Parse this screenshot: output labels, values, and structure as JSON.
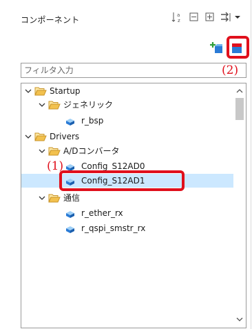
{
  "header": {
    "title": "コンポーネント",
    "icons": [
      "sort-az-icon",
      "collapse-all-icon",
      "expand-all-icon",
      "link-menu-icon",
      "dropdown-arrow-icon"
    ]
  },
  "toolbar": {
    "add_component_icon": "add-component-icon",
    "remove_component_icon": "remove-component-icon"
  },
  "filter": {
    "placeholder": "フィルタ入力"
  },
  "annotations": {
    "label_1": "(1)",
    "label_2": "(2)",
    "color": "#e0101c"
  },
  "tree": {
    "items": [
      {
        "label": "Startup",
        "type": "folder",
        "expanded": true
      },
      {
        "label": "ジェネリック",
        "type": "folder",
        "expanded": true
      },
      {
        "label": "r_bsp",
        "type": "component"
      },
      {
        "label": "Drivers",
        "type": "folder",
        "expanded": true
      },
      {
        "label": "A/Dコンバータ",
        "type": "folder",
        "expanded": true
      },
      {
        "label": "Config_S12AD0",
        "type": "component"
      },
      {
        "label": "Config_S12AD1",
        "type": "component",
        "selected": true
      },
      {
        "label": "通信",
        "type": "folder",
        "expanded": true
      },
      {
        "label": "r_ether_rx",
        "type": "component"
      },
      {
        "label": "r_qspi_smstr_rx",
        "type": "component"
      }
    ]
  },
  "colors": {
    "selection": "#cce8ff",
    "highlight": "#e0101c",
    "folder": "#e8b84a",
    "component": "#2a7bd6"
  }
}
